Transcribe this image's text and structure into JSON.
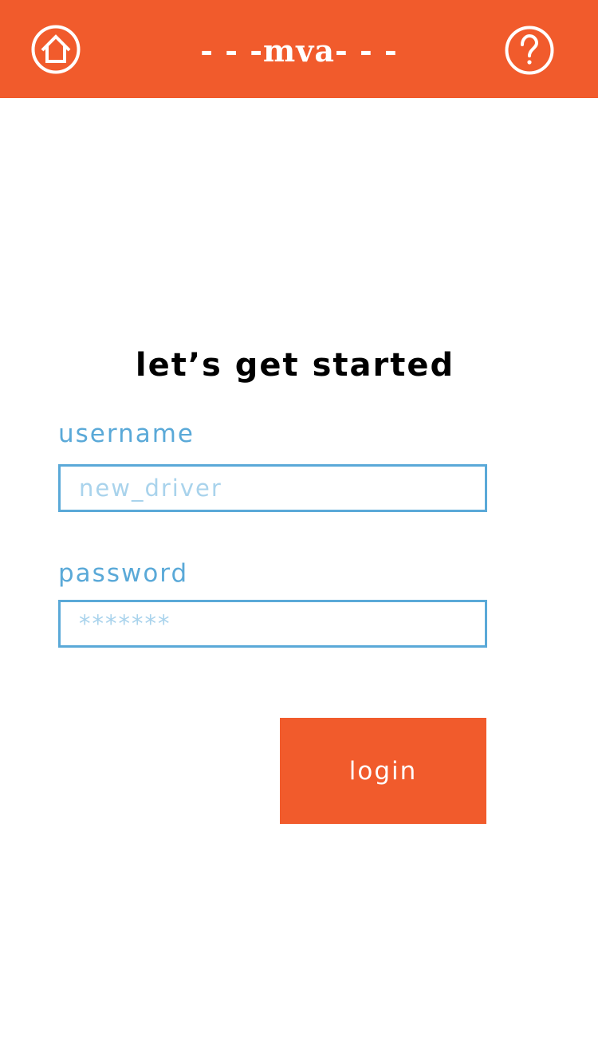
{
  "header": {
    "logo_text": "- - -mva- - -",
    "home_icon": "home-icon",
    "help_icon": "help-icon",
    "background_color": "#f15b2c"
  },
  "main": {
    "heading": "let’s get started",
    "username": {
      "label": "username",
      "placeholder": "new_driver",
      "value": ""
    },
    "password": {
      "label": "password",
      "placeholder": "*******",
      "value": ""
    },
    "login_label": "login"
  },
  "colors": {
    "accent": "#f15b2c",
    "field_blue": "#5aa9d8",
    "placeholder_blue": "#a9d3ec"
  }
}
